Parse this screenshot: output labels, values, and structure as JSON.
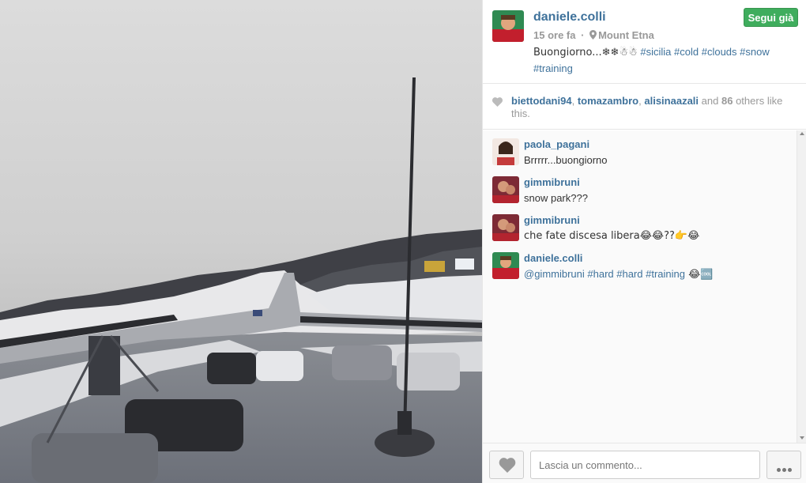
{
  "post": {
    "username": "daniele.colli",
    "time_ago": "15 ore fa",
    "separator": "·",
    "location": "Mount Etna",
    "caption_text": "Buongiorno...❄❄☃☃",
    "caption_tags": [
      "#sicilia",
      "#cold",
      "#clouds",
      "#snow",
      "#training"
    ],
    "follow_label": "Segui già"
  },
  "likes": {
    "likers": [
      "biettodani94",
      "tomazambro",
      "alisinaazali"
    ],
    "sep1": ",",
    "sep2": ",",
    "and_text": "and",
    "others_count": "86",
    "others_text": "others like this."
  },
  "comments": [
    {
      "user": "paola_pagani",
      "text": "Brrrrr...buongiorno"
    },
    {
      "user": "gimmibruni",
      "text": "snow park???"
    },
    {
      "user": "gimmibruni",
      "text": "che fate discesa libera😂😂??👉😂"
    },
    {
      "user": "daniele.colli",
      "text_tags": "@gimmibruni #hard #hard #training",
      "text_suffix": " 😂🆒"
    }
  ],
  "composer": {
    "placeholder": "Lascia un commento..."
  },
  "colors": {
    "link": "#3f729b",
    "follow_green": "#3fad5d"
  },
  "icons": [
    "location-pin-icon",
    "heart-icon",
    "more-dots-icon"
  ]
}
